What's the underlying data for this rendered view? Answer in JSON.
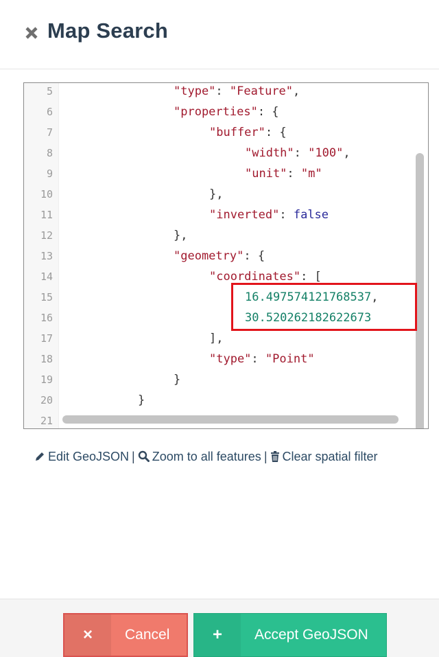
{
  "header": {
    "title": "Map Search",
    "close_icon": "close-x-icon"
  },
  "editor": {
    "lines": [
      {
        "num": "5",
        "segs": [
          [
            "k",
            "\"type\""
          ],
          [
            "p",
            ": "
          ],
          [
            "k",
            "\"Feature\""
          ],
          [
            "p",
            ","
          ]
        ]
      },
      {
        "num": "6",
        "segs": [
          [
            "k",
            "\"properties\""
          ],
          [
            "p",
            ": {"
          ]
        ]
      },
      {
        "num": "7",
        "segs": [
          [
            "k",
            "\"buffer\""
          ],
          [
            "p",
            ": {"
          ]
        ]
      },
      {
        "num": "8",
        "segs": [
          [
            "k",
            "\"width\""
          ],
          [
            "p",
            ": "
          ],
          [
            "k",
            "\"100\""
          ],
          [
            "p",
            ","
          ]
        ]
      },
      {
        "num": "9",
        "segs": [
          [
            "k",
            "\"unit\""
          ],
          [
            "p",
            ": "
          ],
          [
            "k",
            "\"m\""
          ]
        ]
      },
      {
        "num": "10",
        "segs": [
          [
            "p",
            "},"
          ]
        ]
      },
      {
        "num": "11",
        "segs": [
          [
            "k",
            "\"inverted\""
          ],
          [
            "p",
            ": "
          ],
          [
            "b",
            "false"
          ]
        ]
      },
      {
        "num": "12",
        "segs": [
          [
            "p",
            "},"
          ]
        ]
      },
      {
        "num": "13",
        "segs": [
          [
            "k",
            "\"geometry\""
          ],
          [
            "p",
            ": {"
          ]
        ]
      },
      {
        "num": "14",
        "segs": [
          [
            "k",
            "\"coordinates\""
          ],
          [
            "p",
            ": ["
          ]
        ]
      },
      {
        "num": "15",
        "segs": [
          [
            "n",
            "16.497574121768537"
          ],
          [
            "p",
            ","
          ]
        ]
      },
      {
        "num": "16",
        "segs": [
          [
            "n",
            "30.520262182622673"
          ]
        ]
      },
      {
        "num": "17",
        "segs": [
          [
            "p",
            "],"
          ]
        ]
      },
      {
        "num": "18",
        "segs": [
          [
            "k",
            "\"type\""
          ],
          [
            "p",
            ": "
          ],
          [
            "k",
            "\"Point\""
          ]
        ]
      },
      {
        "num": "19",
        "segs": [
          [
            "p",
            "}"
          ]
        ]
      },
      {
        "num": "20",
        "segs": [
          [
            "p",
            "}"
          ]
        ]
      },
      {
        "num": "21",
        "segs": []
      }
    ]
  },
  "links": {
    "edit": "Edit GeoJSON",
    "zoom": "Zoom to all features",
    "clear": "Clear spatial filter",
    "separator": "|"
  },
  "footer": {
    "cancel_label": "Cancel",
    "cancel_icon": "×",
    "accept_label": "Accept GeoJSON",
    "accept_icon": "+"
  },
  "colors": {
    "cancel": "#f07a6c",
    "accept": "#2bbf8f",
    "highlight": "#e2141b"
  }
}
